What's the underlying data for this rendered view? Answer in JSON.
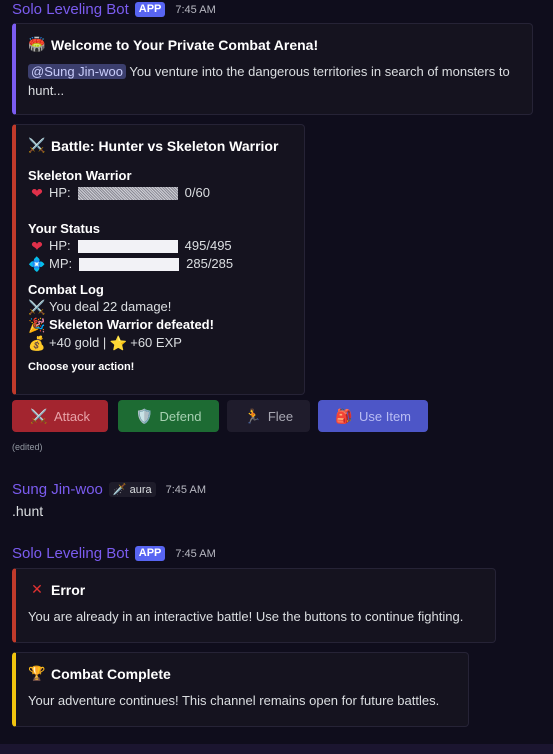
{
  "messages": {
    "first": {
      "author": "Solo Leveling Bot",
      "app_tag": "APP",
      "time": "7:45 AM",
      "welcome": {
        "icon": "🏟️",
        "title": "Welcome to Your Private Combat Arena!",
        "mention": "@Sung Jin-woo",
        "text": " You venture into the dangerous territories in search of monsters to hunt..."
      },
      "battle": {
        "title_icon": "⚔️",
        "title": "Battle: Hunter vs Skeleton Warrior",
        "enemy": {
          "name": "Skeleton Warrior",
          "hp_label": "HP:",
          "hp_value": "0/60"
        },
        "status": {
          "heading": "Your Status",
          "hp_label": "HP:",
          "hp_value": "495/495",
          "mp_label": "MP:",
          "mp_value": "285/285"
        },
        "log": {
          "heading": "Combat Log",
          "line1": "You deal 22 damage!",
          "line2": "Skeleton Warrior defeated!",
          "line3_a": "+40 gold | ",
          "line3_b": "+60 EXP"
        },
        "prompt": "Choose your action!"
      },
      "buttons": {
        "attack": "Attack",
        "defend": "Defend",
        "flee": "Flee",
        "use_item": "Use Item"
      },
      "edited": "(edited)"
    },
    "user": {
      "author": "Sung Jin-woo",
      "role": "aura",
      "time": "7:45 AM",
      "text": ".hunt"
    },
    "second": {
      "author": "Solo Leveling Bot",
      "app_tag": "APP",
      "time": "7:45 AM",
      "error": {
        "title": "Error",
        "text": "You are already in an interactive battle! Use the buttons to continue fighting."
      },
      "complete": {
        "title": "Combat Complete",
        "text": "Your adventure continues! This channel remains open for future battles."
      }
    }
  },
  "colors": {
    "author": "#7b5cf0",
    "welcome_border": "#7b5cf0",
    "battle_border": "#c03a2b",
    "error_border": "#c03a2b",
    "complete_border": "#f1c40f"
  },
  "bars": {
    "enemy_hp_fraction": 0,
    "player_hp_fraction": 1,
    "player_mp_fraction": 1
  }
}
